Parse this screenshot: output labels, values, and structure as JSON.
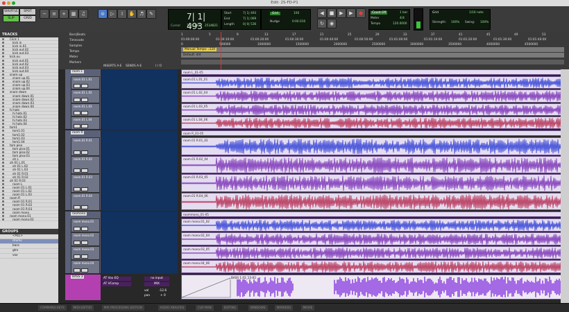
{
  "window": {
    "title": "Edit: 2S-FD-P1"
  },
  "toolbar": {
    "modes": [
      "SHUFFLE",
      "SPOT",
      "SLIP",
      "GRID"
    ],
    "counter": "7| 1| 493",
    "cursor_label": "Cursor",
    "cursor_value": "7| 2| 482",
    "sample_value": "2534821",
    "start_label": "Start",
    "start_value": "7| 1| 493",
    "end_label": "End",
    "end_value": "7| 1| 069",
    "length_label": "Length",
    "length_value": "0| 0| 536",
    "grid_label": "Grid",
    "grid_value": "100",
    "nudge_label": "Nudge",
    "nudge_value": "0:00.010",
    "count_off": "Count Off",
    "meter_label": "Meter",
    "meter_value": "4/4",
    "tempo_label": "Tempo",
    "tempo_value": "120.0000",
    "bar_label": "1 bar",
    "grid_note": "1/16 note",
    "strength_label": "Strength:",
    "strength_value": "100%",
    "swing_label": "Swing:",
    "swing_value": "100%"
  },
  "tracks_panel": {
    "header": "TRACKS",
    "items": [
      "Click 1",
      "kick in",
      "kick in.01",
      "kick out.02",
      "kick out.03",
      "kick.ou",
      "kick out.01",
      "kick out.02",
      "kick out.03",
      "kick out.04",
      "snare up",
      "snare up.01",
      "snare up.02",
      "snare up.03",
      "snare up.04",
      "snare down",
      "snare down.01",
      "snare down.02",
      "snare down.03",
      "snare down.04",
      "hi hats",
      "hi hats.01",
      "hi hats.02",
      "hi hats.03",
      "hi hats.04",
      "tom1",
      "tom1.01",
      "tom1.02",
      "tom1.03",
      "tom1.04",
      "tom piso",
      "tom piso.01",
      "tom piso.02",
      "tom piso.03",
      "oh L",
      "oh 01 L.01",
      "oh 01 L.02",
      "oh 01 L.03",
      "oh 01 R.01",
      "oh 01 R.02",
      "oh 01 R.03",
      "room L",
      "room 01 L.01",
      "room 01 L.02",
      "room 01 L.03",
      "room R",
      "room 01 R.01",
      "room 01 R.02",
      "room 01 R.03",
      "room mono",
      "room mono.01",
      "room mono.02"
    ]
  },
  "groups_panel": {
    "header": "GROUPS",
    "items": [
      "<ALL>",
      "drums",
      "bass",
      "gtrs",
      "vox"
    ],
    "selected": 1
  },
  "ruler": {
    "rows": [
      "Bars|Beats",
      "Timecode",
      "Samples",
      "Tempo",
      "Meter",
      "Markers"
    ],
    "bars": [
      "1",
      "5",
      "9",
      "13",
      "17",
      "21",
      "25",
      "29",
      "33",
      "37",
      "41",
      "45",
      "49",
      "53"
    ],
    "timecode": [
      "01:00:00:00",
      "01:00:10:00",
      "01:00:20:00",
      "01:00:30:00",
      "01:00:40:00",
      "01:00:50:00",
      "01:01:00:00",
      "01:01:10:00",
      "01:01:20:00",
      "01:01:30:00",
      "01:01:40:00"
    ],
    "samples": [
      "0",
      "500000",
      "1000000",
      "1500000",
      "2000000",
      "2500000",
      "3000000",
      "3500000",
      "4000000",
      "4500000"
    ],
    "tempo_marker": "Manual Tempo: ♩120",
    "meter_marker": "Default: 4/4"
  },
  "columns": {
    "inserts": "INSERTS A-E",
    "sends": "SENDS A-E",
    "io": "I / O"
  },
  "tracks": [
    {
      "name": "room L",
      "clip": "room L_01-05",
      "lanes": [
        "room.01 L.01",
        "room.01 L.02",
        "room.01 L.03",
        "room.01 L.04"
      ],
      "lane_clips": [
        "room.01 L.01_01",
        "room.01 L.02_04",
        "room.01 L.03_05",
        "room.01 L.04_06"
      ]
    },
    {
      "name": "room R",
      "clip": "room R_01-05",
      "lanes": [
        "room.01 R.01",
        "room.01 R.02",
        "room.01 R.03",
        "room.01 R.04"
      ],
      "lane_clips": [
        "room.01 R.01_02",
        "room.01 R.02_04",
        "room.01 R.03_05",
        "room.01 R.04_06"
      ]
    },
    {
      "name": "roomono",
      "clip": "roommono_01-05",
      "lanes": [
        "room mono.01",
        "room mono.02",
        "room mono.03",
        "room mono.04"
      ],
      "lane_clips": [
        "room mono.01_02",
        "room mono.02_04",
        "room mono.03_05",
        "room mono.04_06"
      ]
    }
  ],
  "bass": {
    "name": "BASS 3",
    "plugins": [
      "AT Vox EQ",
      "AT VComp"
    ],
    "io_in": "no input",
    "io_out": "MIX",
    "vol_label": "vol",
    "vol_value": "-12.6",
    "pan_label": "pan",
    "pan_value": "+ 0",
    "clip": "BASS 1.02_13-02"
  },
  "status_tabs": [
    "COMMAND KEYS",
    "MIDI EDITOR",
    "MIX PROCESSING EDITION",
    "AUDIO ANALYSIS",
    "CLIP MAN",
    "EDITING",
    "WINDOWS",
    "MARKERS",
    "MOVIE"
  ],
  "colors": {
    "accent": "#7d8fb8",
    "clip_blue": "#2f3fd6",
    "clip_purple": "#7a2fb6",
    "clip_red": "#b52a4e",
    "clip_bg": "#e4dcf0"
  }
}
